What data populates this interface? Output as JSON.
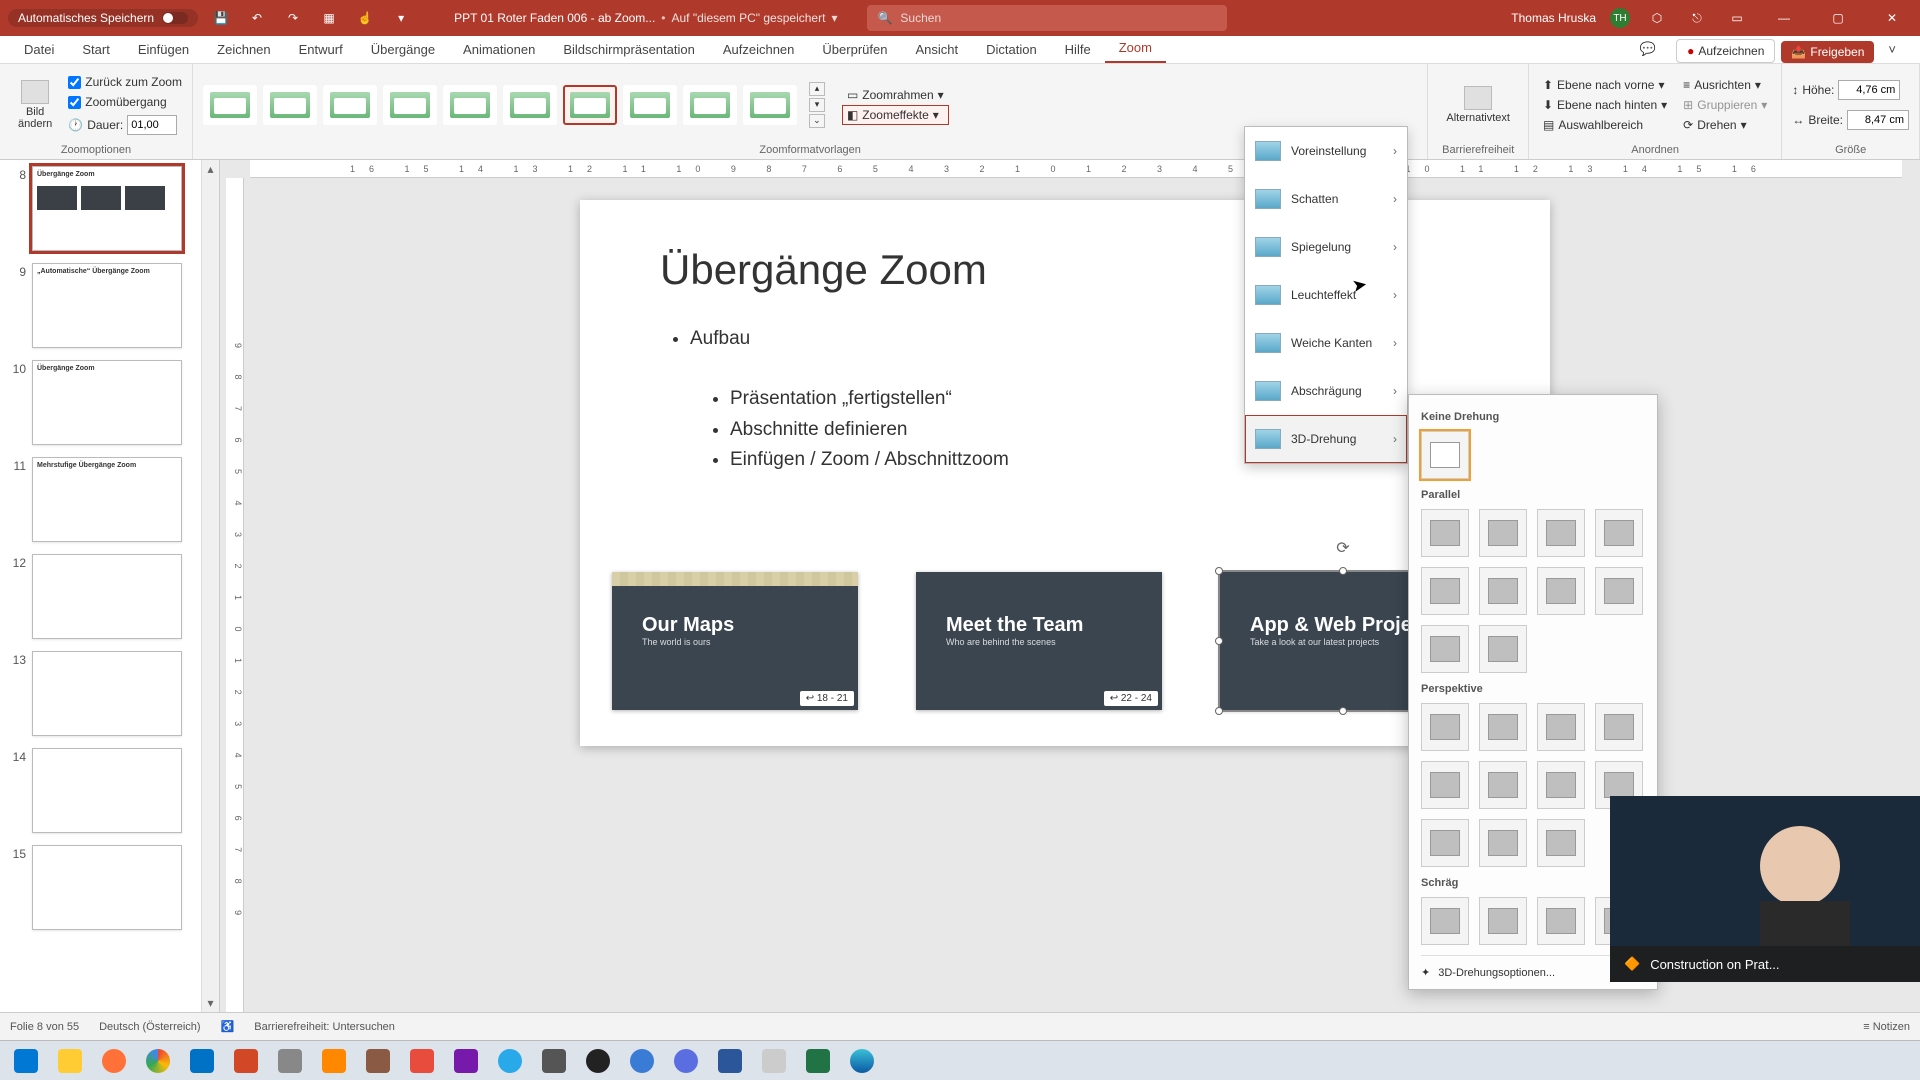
{
  "titlebar": {
    "autosave": "Automatisches Speichern",
    "docname": "PPT 01 Roter Faden 006 - ab Zoom...",
    "savedloc": "Auf \"diesem PC\" gespeichert",
    "search_ph": "Suchen",
    "user": "Thomas Hruska",
    "initials": "TH"
  },
  "tabs": {
    "t0": "Datei",
    "t1": "Start",
    "t2": "Einfügen",
    "t3": "Zeichnen",
    "t4": "Entwurf",
    "t5": "Übergänge",
    "t6": "Animationen",
    "t7": "Bildschirmpräsentation",
    "t8": "Aufzeichnen",
    "t9": "Überprüfen",
    "t10": "Ansicht",
    "t11": "Dictation",
    "t12": "Hilfe",
    "t13": "Zoom",
    "record": "Aufzeichnen",
    "share": "Freigeben"
  },
  "ribbon": {
    "bild_andern": "Bild\nändern",
    "return_zoom": "Zurück zum Zoom",
    "zoom_ubergang": "Zoomübergang",
    "dauer_lbl": "Dauer:",
    "dauer_val": "01,00",
    "grp_options": "Zoomoptionen",
    "grp_styles": "Zoomformatvorlagen",
    "zoomrahmen": "Zoomrahmen",
    "zoomeffekte": "Zoomeffekte",
    "alttext": "Alternativtext",
    "grp_access": "Barrierefreiheit",
    "fwd": "Ebene nach vorne",
    "back": "Ebene nach hinten",
    "selpane": "Auswahlbereich",
    "align": "Ausrichten",
    "group": "Gruppieren",
    "rotate": "Drehen",
    "grp_arrange": "Anordnen",
    "h_lbl": "Höhe:",
    "h_val": "4,76 cm",
    "w_lbl": "Breite:",
    "w_val": "8,47 cm",
    "grp_size": "Größe"
  },
  "fx": {
    "preset": "Voreinstellung",
    "shadow": "Schatten",
    "reflect": "Spiegelung",
    "glow": "Leuchteffekt",
    "soft": "Weiche Kanten",
    "bevel": "Abschrägung",
    "rot3d": "3D-Drehung"
  },
  "rot": {
    "none": "Keine Drehung",
    "parallel": "Parallel",
    "persp": "Perspektive",
    "oblique": "Schräg",
    "opts": "3D-Drehungsoptionen..."
  },
  "slide": {
    "title": "Übergänge Zoom",
    "b1": "Aufbau",
    "b2": "Präsentation „fertigstellen“",
    "b3": "Abschnitte definieren",
    "b4": "Einfügen / Zoom / Abschnittzoom",
    "card1_t": "Our Maps",
    "card1_s": "The world is ours",
    "card1_b": "↩ 18 - 21",
    "card2_t": "Meet the Team",
    "card2_s": "Who are behind the scenes",
    "card2_b": "↩ 22 - 24",
    "card3_t": "App & Web Projects",
    "card3_s": "Take a look at our latest projects",
    "card3_b": "↩"
  },
  "thumbs": {
    "n8": "8",
    "n9": "9",
    "n10": "10",
    "n11": "11",
    "n12": "12",
    "n13": "13",
    "n14": "14",
    "n15": "15",
    "t9": "„Automatische“ Übergänge Zoom",
    "t10": "Übergänge Zoom",
    "t11": "Mehrstufige Übergänge Zoom"
  },
  "status": {
    "slide": "Folie 8 von 55",
    "lang": "Deutsch (Österreich)",
    "access": "Barrierefreiheit: Untersuchen",
    "notes": "Notizen"
  },
  "toast": "Construction on Prat...",
  "ruler_h": "16 15 14 13 12 11 10 9 8 7 6 5 4 3 2 1 0 1 2 3 4 5 6 7 8 9 10 11 12 13 14 15 16",
  "ruler_v": "9 8 7 6 5 4 3 2 1 0 1 2 3 4 5 6 7 8 9"
}
